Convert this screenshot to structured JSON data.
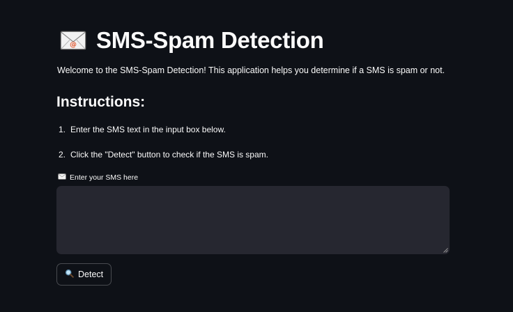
{
  "header": {
    "icon": "envelope-icon",
    "title": "SMS-Spam Detection"
  },
  "intro": {
    "welcome": "Welcome to the SMS-Spam Detection! This application helps you determine if a SMS is spam or not."
  },
  "instructions": {
    "heading": "Instructions:",
    "steps": [
      {
        "num": "1.",
        "text": "Enter the SMS text in the input box below."
      },
      {
        "num": "2.",
        "text": "Click the \"Detect\" button to check if the SMS is spam."
      }
    ]
  },
  "sms_input": {
    "icon": "envelope-icon",
    "label": "Enter your SMS here",
    "value": "",
    "placeholder": ""
  },
  "detect_button": {
    "icon": "magnifier-icon",
    "label": "Detect"
  },
  "colors": {
    "background": "#0e1117",
    "input_background": "#262730",
    "text": "#fafafa"
  }
}
